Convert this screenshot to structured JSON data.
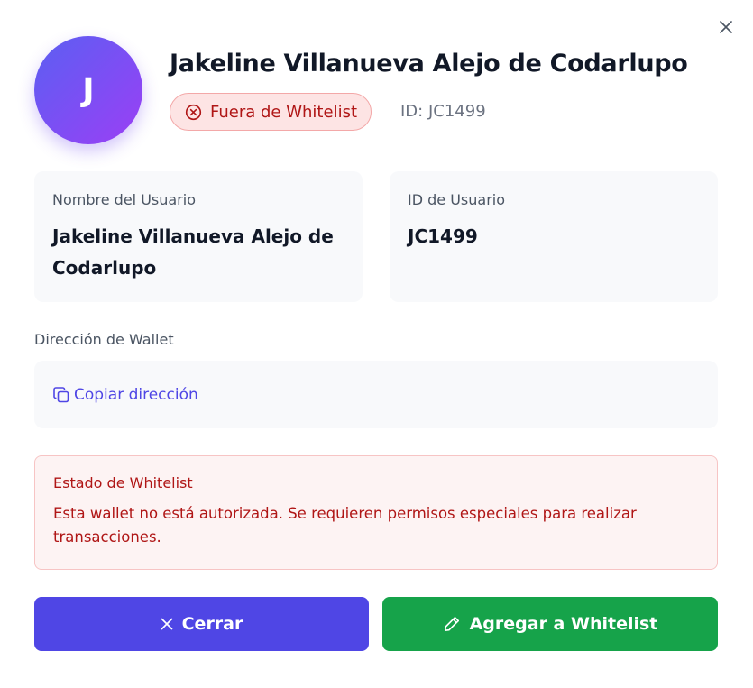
{
  "header": {
    "avatar_initial": "J",
    "name": "Jakeline Villanueva Alejo de Codarlupo",
    "status_badge": "Fuera de Whitelist",
    "id_text": "ID: JC1499"
  },
  "cards": {
    "username_label": "Nombre del Usuario",
    "username_value": "Jakeline Villanueva Alejo de Codarlupo",
    "userid_label": "ID de Usuario",
    "userid_value": "JC1499"
  },
  "wallet": {
    "label": "Dirección de Wallet",
    "copy_label": "Copiar dirección"
  },
  "alert": {
    "title": "Estado de Whitelist",
    "text": "Esta wallet no está autorizada. Se requieren permisos especiales para realizar transacciones."
  },
  "buttons": {
    "close_label": "Cerrar",
    "add_label": "Agregar a Whitelist"
  },
  "icons": {
    "close": "close-icon",
    "status": "x-circle-icon",
    "copy": "copy-icon",
    "close_button": "x-icon",
    "add_button": "pencil-icon"
  },
  "colors": {
    "primary": "#4f46e5",
    "success": "#16a34a",
    "danger": "#b01616",
    "danger_bg": "#fdf3f3"
  }
}
